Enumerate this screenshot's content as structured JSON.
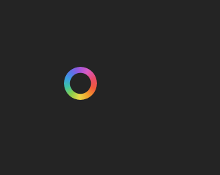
{
  "screen": {
    "background": "#242424"
  },
  "spinner": {
    "icon": "color-wheel-loading-icon",
    "colors": [
      "#a856d8",
      "#e84b6a",
      "#f05a3a",
      "#f2a32c",
      "#e8d84a",
      "#8ccf4a",
      "#3fc3a4",
      "#3a9ee0",
      "#5a74e8"
    ]
  }
}
